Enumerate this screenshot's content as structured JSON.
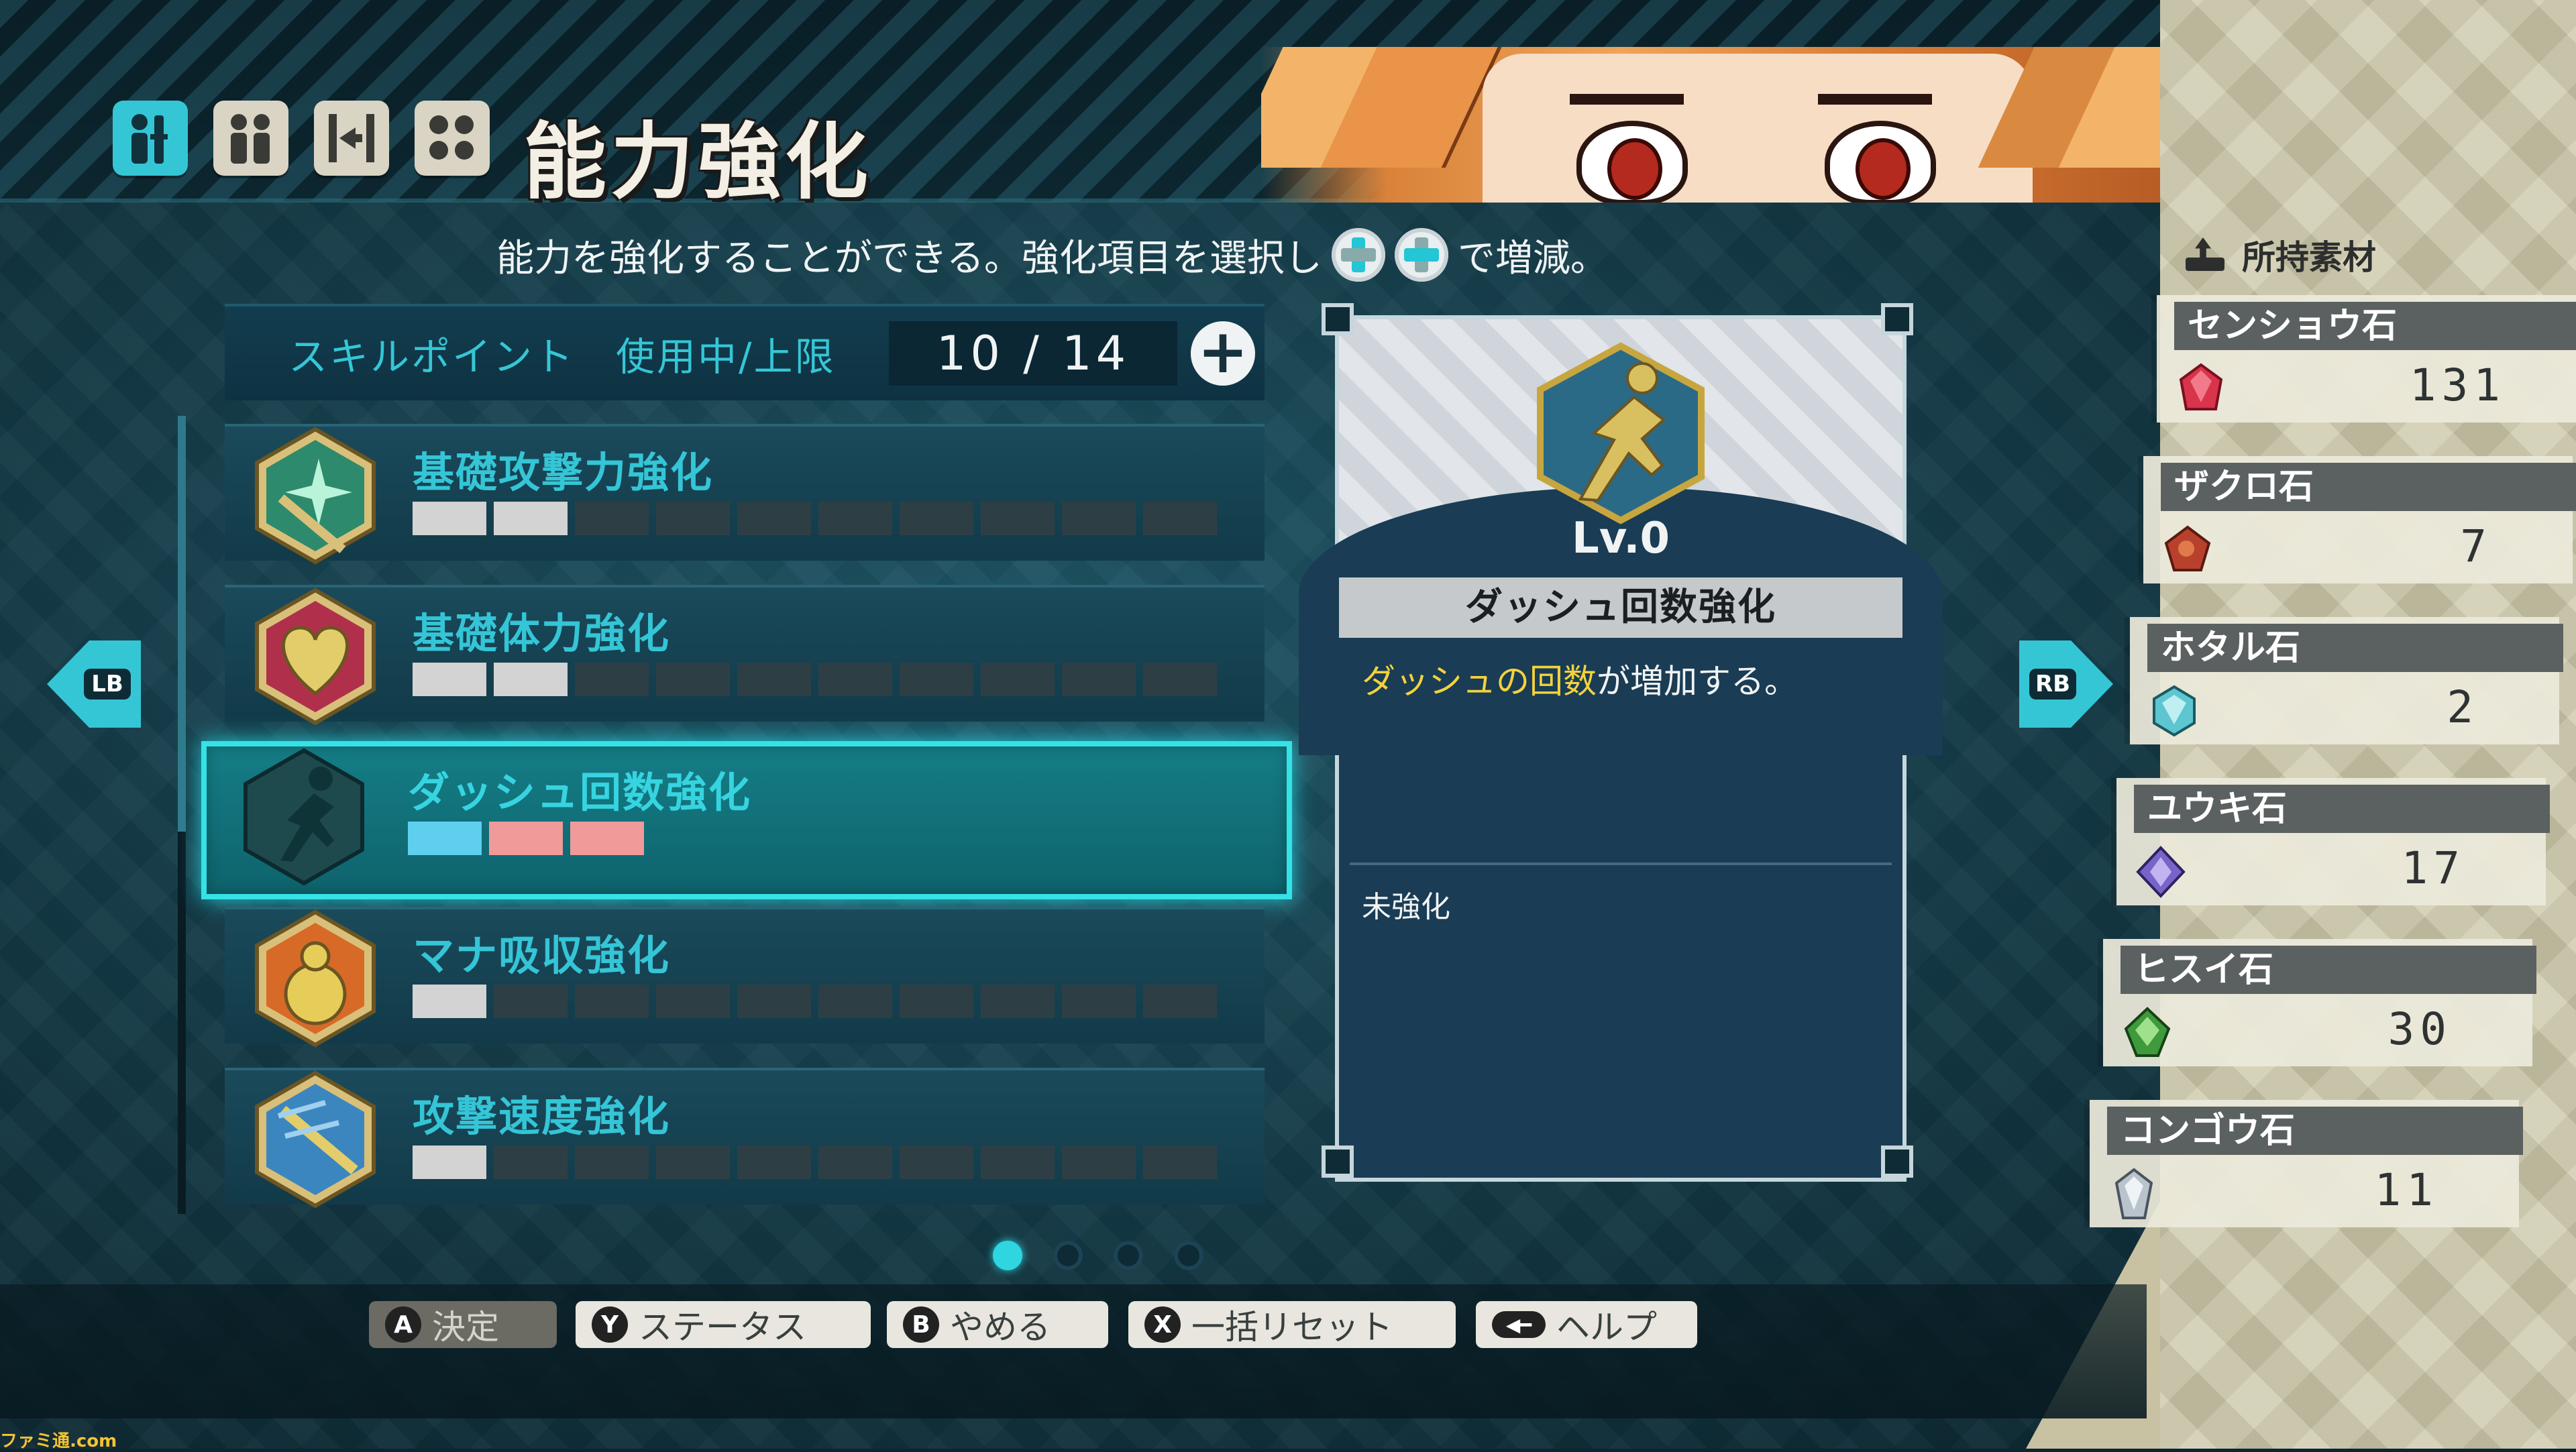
{
  "header": {
    "title": "能力強化",
    "tabs": [
      {
        "name": "status",
        "active": true
      },
      {
        "name": "party",
        "active": false
      },
      {
        "name": "equipment",
        "active": false
      },
      {
        "name": "ability",
        "active": false
      }
    ]
  },
  "instruction": {
    "text": "能力を強化することができる。強化項目を選択し",
    "suffix": "で増減。"
  },
  "skill_points": {
    "label": "スキルポイント　使用中/上限",
    "value": "10 / 14",
    "plus": "+"
  },
  "skills": [
    {
      "name": "基礎攻撃力強化",
      "icon": "sword-star-icon",
      "filled": 2,
      "total": 10,
      "selected": false
    },
    {
      "name": "基礎体力強化",
      "icon": "heart-icon",
      "filled": 2,
      "total": 10,
      "selected": false
    },
    {
      "name": "ダッシュ回数強化",
      "icon": "dash-runner-icon",
      "filled": 0,
      "total": 3,
      "selected": true
    },
    {
      "name": "マナ吸収強化",
      "icon": "mana-flask-icon",
      "filled": 1,
      "total": 10,
      "selected": false
    },
    {
      "name": "攻撃速度強化",
      "icon": "sword-speed-icon",
      "filled": 1,
      "total": 10,
      "selected": false
    }
  ],
  "nav": {
    "left": "LB",
    "right": "RB"
  },
  "detail": {
    "level": "Lv.0",
    "name": "ダッシュ回数強化",
    "desc_highlight": "ダッシュの回数",
    "desc_rest": "が増加する。",
    "status": "未強化"
  },
  "pages": {
    "total": 4,
    "current": 1
  },
  "materials": {
    "title": "所持素材",
    "items": [
      {
        "name": "センショウ石",
        "count": "131",
        "color": "#d8344a"
      },
      {
        "name": "ザクロ石",
        "count": "7",
        "color": "#b8412e"
      },
      {
        "name": "ホタル石",
        "count": "2",
        "color": "#5ec6d0"
      },
      {
        "name": "ユウキ石",
        "count": "17",
        "color": "#7a63c8"
      },
      {
        "name": "ヒスイ石",
        "count": "30",
        "color": "#3e9a3a"
      },
      {
        "name": "コンゴウ石",
        "count": "11",
        "color": "#b9c3cc"
      }
    ]
  },
  "buttons": [
    {
      "glyph": "A",
      "label": "決定",
      "dim": true
    },
    {
      "glyph": "Y",
      "label": "ステータス",
      "dim": false
    },
    {
      "glyph": "B",
      "label": "やめる",
      "dim": false
    },
    {
      "glyph": "X",
      "label": "一括リセット",
      "dim": false
    },
    {
      "glyph": "◀━",
      "label": "ヘルプ",
      "dim": false
    }
  ],
  "watermark": "ファミ通.com",
  "colors": {
    "accent": "#35c6d6",
    "highlight": "#f4d23c",
    "pink": "#f09a9a"
  }
}
